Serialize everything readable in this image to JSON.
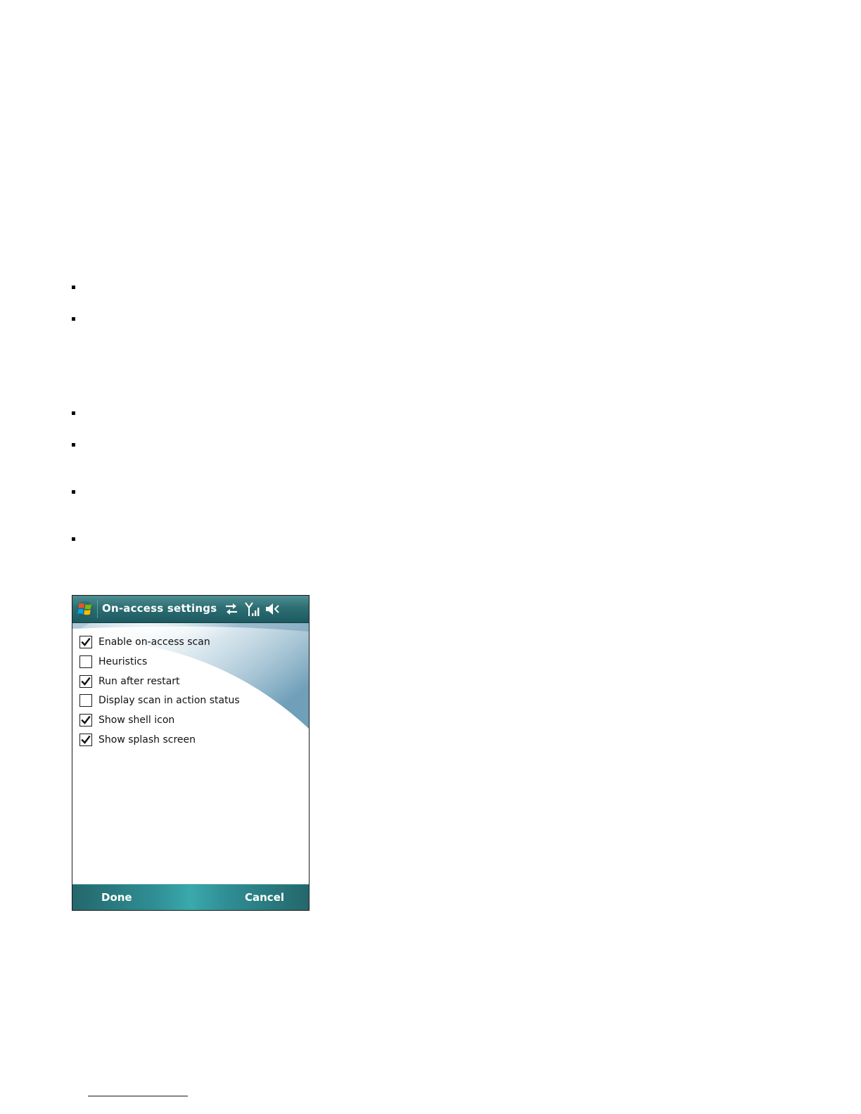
{
  "dialog": {
    "title": "On-access settings",
    "status_icons": [
      "connectivity-icon",
      "signal-strength-icon",
      "speaker-muted-icon"
    ],
    "options": [
      {
        "label": "Enable on-access scan",
        "checked": true
      },
      {
        "label": "Heuristics",
        "checked": false
      },
      {
        "label": "Run after restart",
        "checked": true
      },
      {
        "label": "Display scan in action status",
        "checked": false
      },
      {
        "label": "Show shell icon",
        "checked": true
      },
      {
        "label": "Show splash screen",
        "checked": true
      }
    ],
    "softkeys": {
      "left": "Done",
      "right": "Cancel"
    }
  },
  "colors": {
    "titlebar": "#2d6e73",
    "softkeys": "#2f8f94",
    "text": "#111111"
  }
}
